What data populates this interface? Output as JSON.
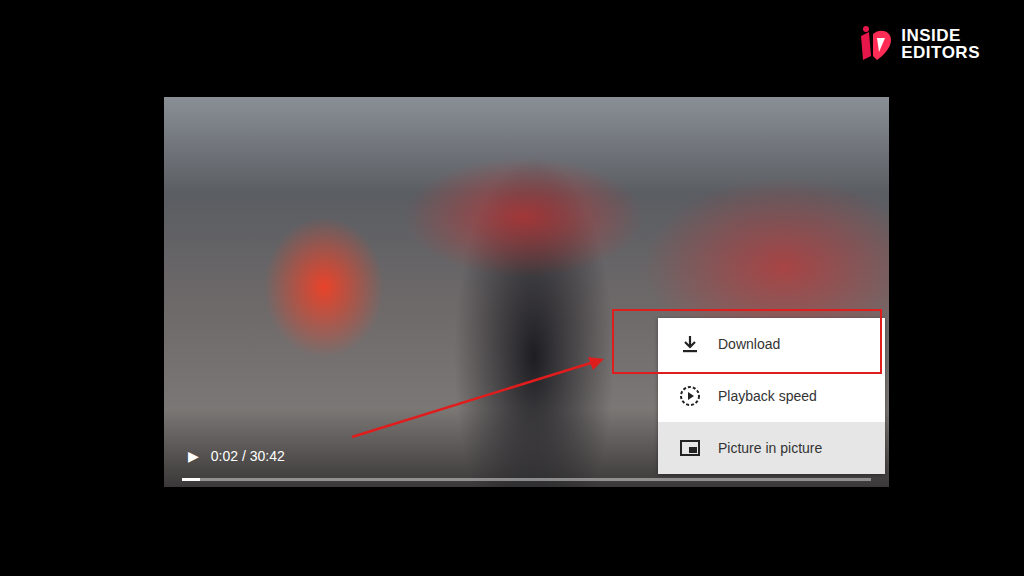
{
  "logo": {
    "line1": "INSIDE",
    "line2": "EDITORS"
  },
  "player": {
    "play_icon": "▶",
    "time": "0:02 / 30:42",
    "progress": {
      "level": 0.026
    }
  },
  "menu": [
    {
      "label": "Download",
      "kind": "download",
      "highlighted": true,
      "hovered": false
    },
    {
      "label": "Playback speed",
      "kind": "speed",
      "highlighted": false,
      "hovered": false
    },
    {
      "label": "Picture in picture",
      "kind": "pip",
      "highlighted": false,
      "hovered": true
    }
  ]
}
